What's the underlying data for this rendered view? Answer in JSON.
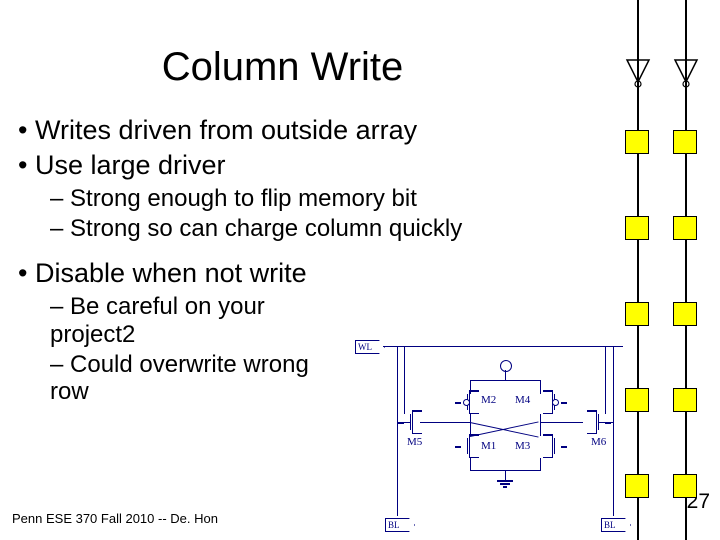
{
  "title": "Column Write",
  "bullets": {
    "b1": "Writes driven from outside array",
    "b2": "Use large driver",
    "s1": "Strong enough to flip memory bit",
    "s2": "Strong so can charge column quickly",
    "b3": "Disable when not write",
    "s3": "Be careful on your project2",
    "s4": "Could overwrite wrong row"
  },
  "footer": "Penn ESE 370 Fall 2010 -- De. Hon",
  "page": "27",
  "schematic": {
    "wl": "WL",
    "bl": "BL",
    "blb": "BL",
    "m1": "M1",
    "m2": "M2",
    "m3": "M3",
    "m4": "M4",
    "m5": "M5",
    "m6": "M6"
  }
}
